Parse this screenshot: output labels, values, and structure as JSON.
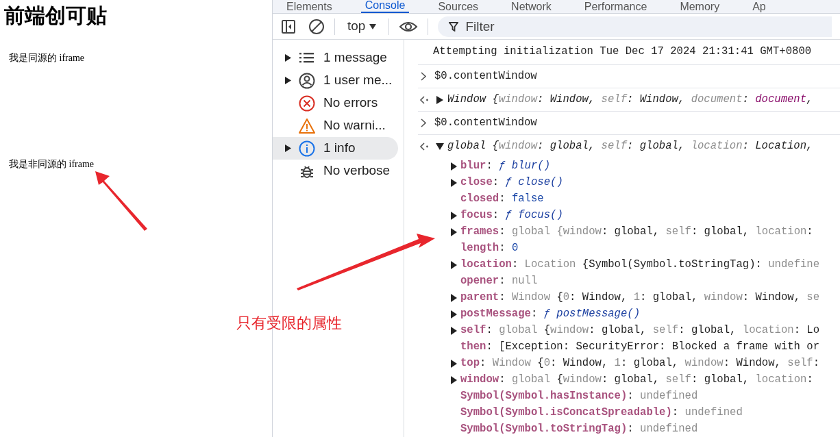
{
  "page": {
    "heading": "前端创可贴",
    "frames": [
      "我是同源的 iframe",
      "我是非同源的 iframe"
    ]
  },
  "annotation": {
    "text": "只有受限的属性"
  },
  "devtools": {
    "tabs": [
      {
        "label": "Elements",
        "selected": false
      },
      {
        "label": "Console",
        "selected": true
      },
      {
        "label": "Sources",
        "selected": false
      },
      {
        "label": "Network",
        "selected": false
      },
      {
        "label": "Performance",
        "selected": false
      },
      {
        "label": "Memory",
        "selected": false
      },
      {
        "label": "Ap",
        "selected": false
      }
    ],
    "toolbar": {
      "context": "top",
      "filter_placeholder": "Filter"
    },
    "sidebar": [
      {
        "kind": "list",
        "label": "1 message",
        "expandable": true,
        "selected": false
      },
      {
        "kind": "user",
        "label": "1 user me...",
        "expandable": true,
        "selected": false
      },
      {
        "kind": "error",
        "label": "No errors",
        "expandable": false,
        "selected": false
      },
      {
        "kind": "warning",
        "label": "No warni...",
        "expandable": false,
        "selected": false
      },
      {
        "kind": "info",
        "label": "1 info",
        "expandable": true,
        "selected": true
      },
      {
        "kind": "bug",
        "label": "No verbose",
        "expandable": false,
        "selected": false
      }
    ],
    "console": [
      {
        "kind": "log",
        "segments": [
          {
            "kind": "text",
            "text": "Attempting initialization Tue Dec 17 2024 21:31:41 GMT+0800"
          }
        ]
      },
      {
        "kind": "input",
        "segments": [
          {
            "kind": "text",
            "text": "$0.contentWindow"
          }
        ]
      },
      {
        "kind": "result",
        "expanded": false,
        "segments": [
          {
            "kind": "text",
            "text": "Window {"
          },
          {
            "kind": "dim",
            "text": "window"
          },
          {
            "kind": "text",
            "text": ": Window, "
          },
          {
            "kind": "dim",
            "text": "self"
          },
          {
            "kind": "text",
            "text": ": Window, "
          },
          {
            "kind": "dim",
            "text": "document"
          },
          {
            "kind": "text",
            "text": ": "
          },
          {
            "kind": "node",
            "text": "document"
          },
          {
            "kind": "text",
            "text": ","
          }
        ]
      },
      {
        "kind": "input",
        "segments": [
          {
            "kind": "text",
            "text": "$0.contentWindow"
          }
        ]
      },
      {
        "kind": "result",
        "expanded": true,
        "segments": [
          {
            "kind": "text",
            "text": "global {"
          },
          {
            "kind": "dim",
            "text": "window"
          },
          {
            "kind": "text",
            "text": ": global, "
          },
          {
            "kind": "dim",
            "text": "self"
          },
          {
            "kind": "text",
            "text": ": global, "
          },
          {
            "kind": "dim",
            "text": "location"
          },
          {
            "kind": "text",
            "text": ": Location,"
          }
        ],
        "children": [
          {
            "expandable": true,
            "segments": [
              {
                "kind": "key",
                "text": "blur"
              },
              {
                "kind": "text",
                "text": ": "
              },
              {
                "kind": "fn",
                "text": "ƒ blur()"
              }
            ]
          },
          {
            "expandable": true,
            "segments": [
              {
                "kind": "key",
                "text": "close"
              },
              {
                "kind": "text",
                "text": ": "
              },
              {
                "kind": "fn",
                "text": "ƒ close()"
              }
            ]
          },
          {
            "expandable": false,
            "segments": [
              {
                "kind": "key",
                "text": "closed"
              },
              {
                "kind": "text",
                "text": ": "
              },
              {
                "kind": "num",
                "text": "false"
              }
            ]
          },
          {
            "expandable": true,
            "segments": [
              {
                "kind": "key",
                "text": "focus"
              },
              {
                "kind": "text",
                "text": ": "
              },
              {
                "kind": "fn",
                "text": "ƒ focus()"
              }
            ]
          },
          {
            "expandable": true,
            "segments": [
              {
                "kind": "key",
                "text": "frames"
              },
              {
                "kind": "text",
                "text": ": "
              },
              {
                "kind": "dim",
                "text": "global {window"
              },
              {
                "kind": "text",
                "text": ": global, "
              },
              {
                "kind": "dim",
                "text": "self"
              },
              {
                "kind": "text",
                "text": ": global, "
              },
              {
                "kind": "dim",
                "text": "location"
              },
              {
                "kind": "text",
                "text": ":"
              }
            ]
          },
          {
            "expandable": false,
            "segments": [
              {
                "kind": "key",
                "text": "length"
              },
              {
                "kind": "text",
                "text": ": "
              },
              {
                "kind": "num",
                "text": "0"
              }
            ]
          },
          {
            "expandable": true,
            "segments": [
              {
                "kind": "key",
                "text": "location"
              },
              {
                "kind": "text",
                "text": ": "
              },
              {
                "kind": "dim",
                "text": "Location "
              },
              {
                "kind": "text",
                "text": "{Symbol(Symbol.toStringTag): "
              },
              {
                "kind": "dim",
                "text": "undefine"
              }
            ]
          },
          {
            "expandable": false,
            "segments": [
              {
                "kind": "key",
                "text": "opener"
              },
              {
                "kind": "text",
                "text": ": "
              },
              {
                "kind": "dim",
                "text": "null"
              }
            ]
          },
          {
            "expandable": true,
            "segments": [
              {
                "kind": "key",
                "text": "parent"
              },
              {
                "kind": "text",
                "text": ": "
              },
              {
                "kind": "dim",
                "text": "Window "
              },
              {
                "kind": "text",
                "text": "{"
              },
              {
                "kind": "dim",
                "text": "0"
              },
              {
                "kind": "text",
                "text": ": Window, "
              },
              {
                "kind": "dim",
                "text": "1"
              },
              {
                "kind": "text",
                "text": ": global, "
              },
              {
                "kind": "dim",
                "text": "window"
              },
              {
                "kind": "text",
                "text": ": Window, "
              },
              {
                "kind": "dim",
                "text": "se"
              }
            ]
          },
          {
            "expandable": true,
            "segments": [
              {
                "kind": "key",
                "text": "postMessage"
              },
              {
                "kind": "text",
                "text": ": "
              },
              {
                "kind": "fn",
                "text": "ƒ postMessage()"
              }
            ]
          },
          {
            "expandable": true,
            "segments": [
              {
                "kind": "key",
                "text": "self"
              },
              {
                "kind": "text",
                "text": ": "
              },
              {
                "kind": "dim",
                "text": "global "
              },
              {
                "kind": "text",
                "text": "{"
              },
              {
                "kind": "dim",
                "text": "window"
              },
              {
                "kind": "text",
                "text": ": global, "
              },
              {
                "kind": "dim",
                "text": "self"
              },
              {
                "kind": "text",
                "text": ": global, "
              },
              {
                "kind": "dim",
                "text": "location"
              },
              {
                "kind": "text",
                "text": ": Lo"
              }
            ]
          },
          {
            "expandable": false,
            "segments": [
              {
                "kind": "key",
                "text": "then"
              },
              {
                "kind": "text",
                "text": ": [Exception: SecurityError: Blocked a frame with or"
              }
            ]
          },
          {
            "expandable": true,
            "segments": [
              {
                "kind": "key",
                "text": "top"
              },
              {
                "kind": "text",
                "text": ": "
              },
              {
                "kind": "dim",
                "text": "Window "
              },
              {
                "kind": "text",
                "text": "{"
              },
              {
                "kind": "dim",
                "text": "0"
              },
              {
                "kind": "text",
                "text": ": Window, "
              },
              {
                "kind": "dim",
                "text": "1"
              },
              {
                "kind": "text",
                "text": ": global, "
              },
              {
                "kind": "dim",
                "text": "window"
              },
              {
                "kind": "text",
                "text": ": Window, "
              },
              {
                "kind": "dim",
                "text": "self"
              },
              {
                "kind": "text",
                "text": ":"
              }
            ]
          },
          {
            "expandable": true,
            "segments": [
              {
                "kind": "key",
                "text": "window"
              },
              {
                "kind": "text",
                "text": ": "
              },
              {
                "kind": "dim",
                "text": "global "
              },
              {
                "kind": "text",
                "text": "{"
              },
              {
                "kind": "dim",
                "text": "window"
              },
              {
                "kind": "text",
                "text": ": global, "
              },
              {
                "kind": "dim",
                "text": "self"
              },
              {
                "kind": "text",
                "text": ": global, "
              },
              {
                "kind": "dim",
                "text": "location"
              },
              {
                "kind": "text",
                "text": ":"
              }
            ]
          },
          {
            "expandable": false,
            "segments": [
              {
                "kind": "key",
                "text": "Symbol(Symbol.hasInstance)"
              },
              {
                "kind": "text",
                "text": ": "
              },
              {
                "kind": "dim",
                "text": "undefined"
              }
            ]
          },
          {
            "expandable": false,
            "segments": [
              {
                "kind": "key",
                "text": "Symbol(Symbol.isConcatSpreadable)"
              },
              {
                "kind": "text",
                "text": ": "
              },
              {
                "kind": "dim",
                "text": "undefined"
              }
            ]
          },
          {
            "expandable": false,
            "segments": [
              {
                "kind": "key",
                "text": "Symbol(Symbol.toStringTag)"
              },
              {
                "kind": "text",
                "text": ": "
              },
              {
                "kind": "dim",
                "text": "undefined"
              }
            ]
          }
        ]
      }
    ]
  }
}
